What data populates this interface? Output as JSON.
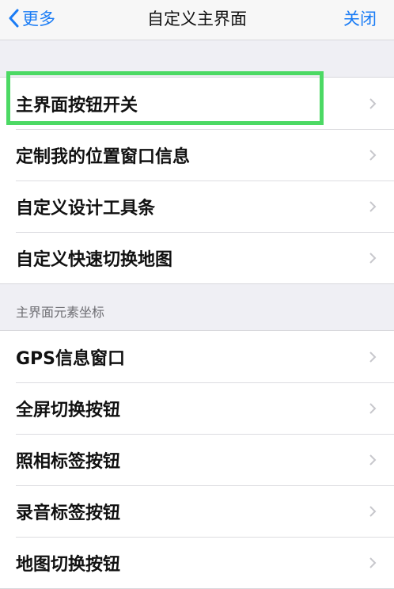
{
  "nav": {
    "back_label": "更多",
    "title": "自定义主界面",
    "close_label": "关闭"
  },
  "group1": {
    "items": [
      {
        "label": "主界面按钮开关"
      },
      {
        "label": "定制我的位置窗口信息"
      },
      {
        "label": "自定义设计工具条"
      },
      {
        "label": "自定义快速切换地图"
      }
    ]
  },
  "section2": {
    "header": "主界面元素坐标",
    "items": [
      {
        "label": "GPS信息窗口"
      },
      {
        "label": "全屏切换按钮"
      },
      {
        "label": "照相标签按钮"
      },
      {
        "label": "录音标签按钮"
      },
      {
        "label": "地图切换按钮"
      }
    ]
  },
  "colors": {
    "accent": "#1a7cf5",
    "highlight": "#4cd964",
    "background": "#efeff4"
  }
}
